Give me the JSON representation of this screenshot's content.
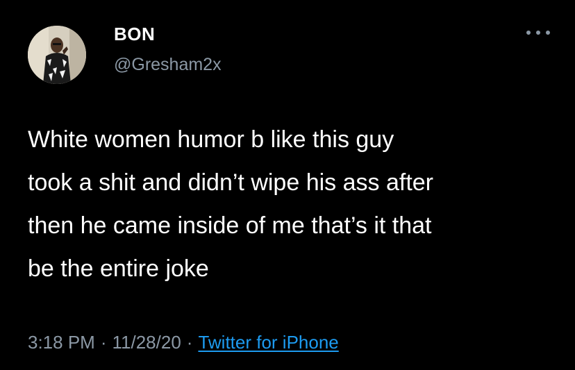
{
  "tweet": {
    "author": {
      "display_name": "BON",
      "handle": "@Gresham2x",
      "avatar_icon": "profile-photo"
    },
    "more_icon": "ellipsis-icon",
    "text": "White women humor b like this guy\ntook a shit and didn’t wipe his ass after\nthen he came inside of me that’s it that\nbe the entire joke",
    "time": "3:18 PM",
    "separator": "·",
    "date": "11/28/20",
    "source": "Twitter for iPhone"
  },
  "colors": {
    "background": "#000000",
    "text": "#ffffff",
    "secondary": "#8b98a5",
    "link": "#1d9bf0"
  }
}
